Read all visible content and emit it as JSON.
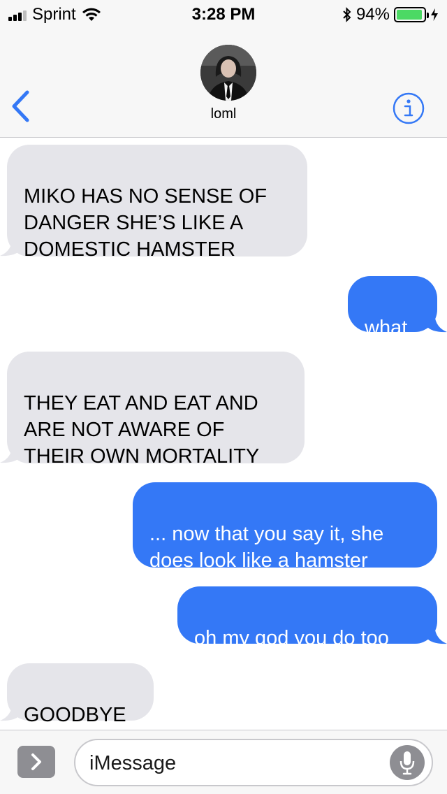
{
  "status_bar": {
    "carrier": "Sprint",
    "time": "3:28 PM",
    "battery_percent": "94%",
    "battery_level": 0.94,
    "signal_bars": 3
  },
  "header": {
    "contact_name": "loml",
    "back_icon": "chevron-left-icon",
    "info_icon": "info-icon"
  },
  "messages": [
    {
      "direction": "incoming",
      "text": "MIKO HAS NO SENSE OF\nDANGER SHE’S LIKE A\nDOMESTIC HAMSTER"
    },
    {
      "direction": "outgoing",
      "text": "what"
    },
    {
      "direction": "incoming",
      "text": "THEY EAT AND EAT AND\nARE NOT AWARE OF\nTHEIR OWN MORTALITY"
    },
    {
      "direction": "outgoing",
      "text": "... now that you say it, she\ndoes look like a hamster"
    },
    {
      "direction": "outgoing",
      "text": "oh my god you do too"
    },
    {
      "direction": "incoming",
      "text": "GOODBYE"
    }
  ],
  "input_bar": {
    "placeholder": "iMessage",
    "apps_icon": "chevron-right-icon",
    "mic_icon": "microphone-icon"
  },
  "colors": {
    "outgoing_bubble": "#3478f6",
    "incoming_bubble": "#e5e5ea",
    "accent": "#3478f6"
  }
}
